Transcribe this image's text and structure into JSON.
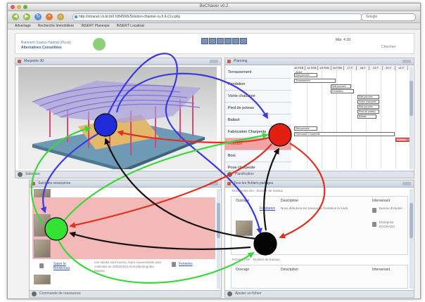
{
  "window": {
    "title": "BeCNaver v0.2"
  },
  "toolbar": {
    "url": "http://intranet.r.b.br.br6.h/8450/b/Solution-chantier-ru.fr.ll-c3.v.php",
    "search_placeholder": "Google"
  },
  "bookmarks": [
    "Advertage",
    "Recherche Immobiliere",
    "INSERT Planexpe",
    "INSERT Localisat"
  ],
  "app": {
    "brand_line1": "Batiment Station Habitat (Plesk)",
    "brand_line2": "Alternatives Conseillées",
    "date": "Mar. 4 2d",
    "search_label": "Chercher"
  },
  "panels": {
    "model": {
      "title": "Maquette 3D"
    },
    "planning": {
      "title": "Planning",
      "columns": [
        "10 FEB 2010",
        "14 FEB",
        "15 FEB",
        "16 FEB",
        "17 F",
        "18 F",
        "19 F",
        "20 F",
        "21 F"
      ],
      "tasks": [
        "Terrassement",
        "Fondation",
        "Voirie chaussee",
        "Pied de poteau",
        "Ballast",
        "Fabrication Charpente",
        "Poteaux",
        "Bois",
        "Pose charpente"
      ],
      "bars": [
        "Etat pavures",
        "Terrassement",
        "Etat pavures",
        "Fondation",
        "Etat pavures",
        "Voirie chaussee",
        "Etat pavures",
        "Pied de poteau",
        "Ballast",
        "Etat pavures",
        "Fabrication Charpente",
        "Poteaux"
      ]
    },
    "resources": {
      "title": "Suivi des ressources",
      "items": [
        {
          "link": "Saisir le Bordereau",
          "text": "Les stocks sont fournis, leurs mouvements sont controles au 15/02/2010 et le planning des travaux"
        },
        {
          "link": "Fenetres",
          "text": "Pose fenetres"
        }
      ]
    },
    "documents": {
      "title": "Tous les fichiers partages",
      "subheader1": "Documents liés - Dossier de travaux",
      "columns": [
        "Ouvrage",
        "Description",
        "Intervenant"
      ],
      "items": [
        {
          "link": "Fondation",
          "text": "Nous debutons les travaux de fondation le lundi",
          "person_role": "Bureau d'etudes",
          "person2": "Entreprise ECOSAGA"
        }
      ],
      "subheader2": "Fichiers PDF - Dossier de travaux",
      "columns2": [
        "Ouvrage",
        "Description",
        "Intervenant"
      ]
    }
  },
  "footers": {
    "model": "Selection",
    "planning": "Planification",
    "resources": "Commande de ressources",
    "documents": "Ajouter un fichier"
  },
  "overlay_nodes": [
    {
      "name": "blue-node",
      "color": "#1f2bd8"
    },
    {
      "name": "red-node",
      "color": "#e21f10"
    },
    {
      "name": "green-node",
      "color": "#33e232"
    },
    {
      "name": "black-node",
      "color": "#050505"
    }
  ],
  "arrow_colors": {
    "blue": "#3a3ae0",
    "red": "#e2301e",
    "green": "#39d83a",
    "black": "#111111"
  }
}
